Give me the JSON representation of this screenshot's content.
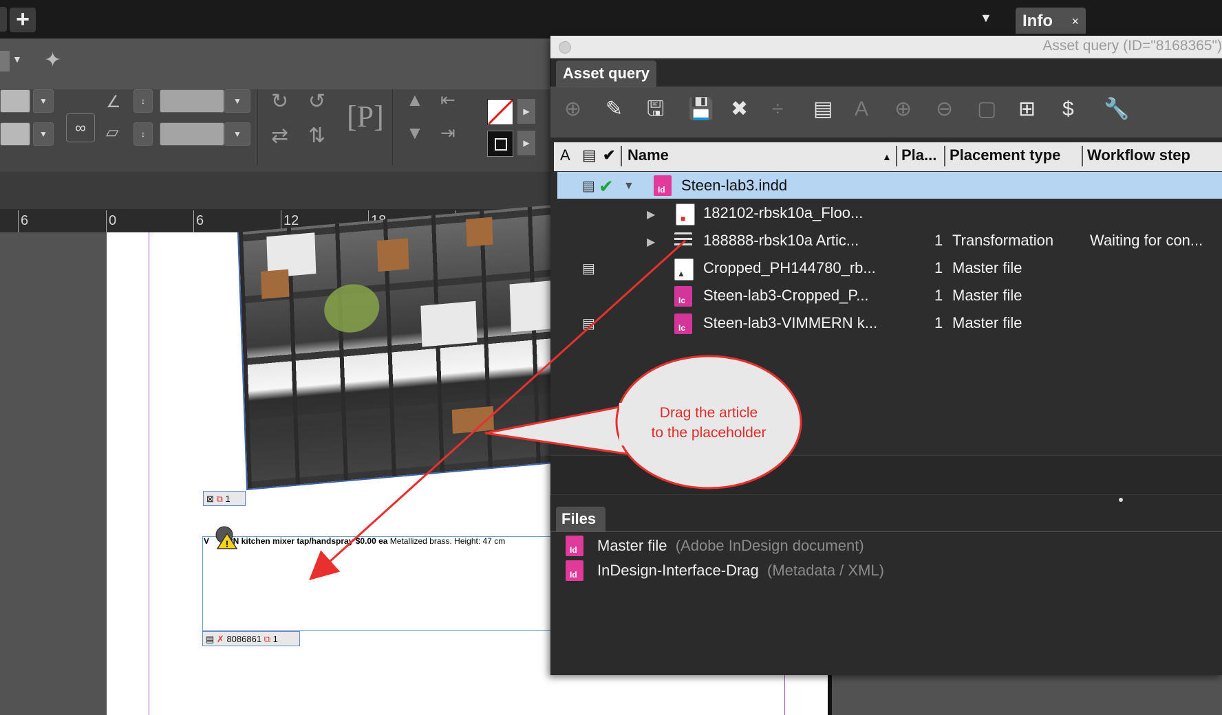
{
  "top_tabs": {
    "add_label": "+",
    "dropdown_icon": "chevron-down-icon",
    "info_label": "Info",
    "info_close": "×"
  },
  "ruler": {
    "ticks": [
      "6",
      "0",
      "6",
      "12",
      "18",
      "24",
      "3"
    ]
  },
  "document": {
    "photo_frame_label": "1",
    "text_frame_content_bold_a": "V",
    "text_frame_content_bold_b": "RN  kitchen mixer tap/handspray $0.00 ea",
    "text_frame_content_light": " Metallized brass. Height: 47 cm",
    "text_frame_id": "8086861",
    "text_frame_page": "1"
  },
  "panel": {
    "window_title": "Asset query (ID=\"8168365\")",
    "tab_label": "Asset query",
    "toolbar_icons": [
      "add-icon",
      "edit-icon",
      "save-copy-icon",
      "save-icon",
      "delete-icon",
      "split-icon",
      "list-icon",
      "text-icon",
      "plus-circle-icon",
      "minus-circle-icon",
      "frame-icon",
      "structure-icon",
      "dollar-icon",
      "wrench-icon"
    ],
    "columns": {
      "name": "Name",
      "placements": "Pla...",
      "placement_type": "Placement type",
      "workflow_step": "Workflow step"
    },
    "rows": [
      {
        "name": "Steen-lab3.indd",
        "count": "",
        "type": "",
        "step": ""
      },
      {
        "name": "182102-rbsk10a_Floo...",
        "count": "",
        "type": "",
        "step": ""
      },
      {
        "name": "188888-rbsk10a Artic...",
        "count": "1",
        "type": "Transformation",
        "step": "Waiting for con..."
      },
      {
        "name": "Cropped_PH144780_rb...",
        "count": "1",
        "type": "Master file",
        "step": ""
      },
      {
        "name": "Steen-lab3-Cropped_P...",
        "count": "1",
        "type": "Master file",
        "step": ""
      },
      {
        "name": "Steen-lab3-VIMMERN  k...",
        "count": "1",
        "type": "Master file",
        "step": ""
      }
    ],
    "files_tab": "Files",
    "files": [
      {
        "name": "Master file",
        "type": "(Adobe InDesign document)"
      },
      {
        "name": "InDesign-Interface-Drag",
        "type": "(Metadata / XML)"
      }
    ]
  },
  "callout": {
    "line1": "Drag the article",
    "line2": "to the placeholder",
    "color": "#e02b2b"
  }
}
